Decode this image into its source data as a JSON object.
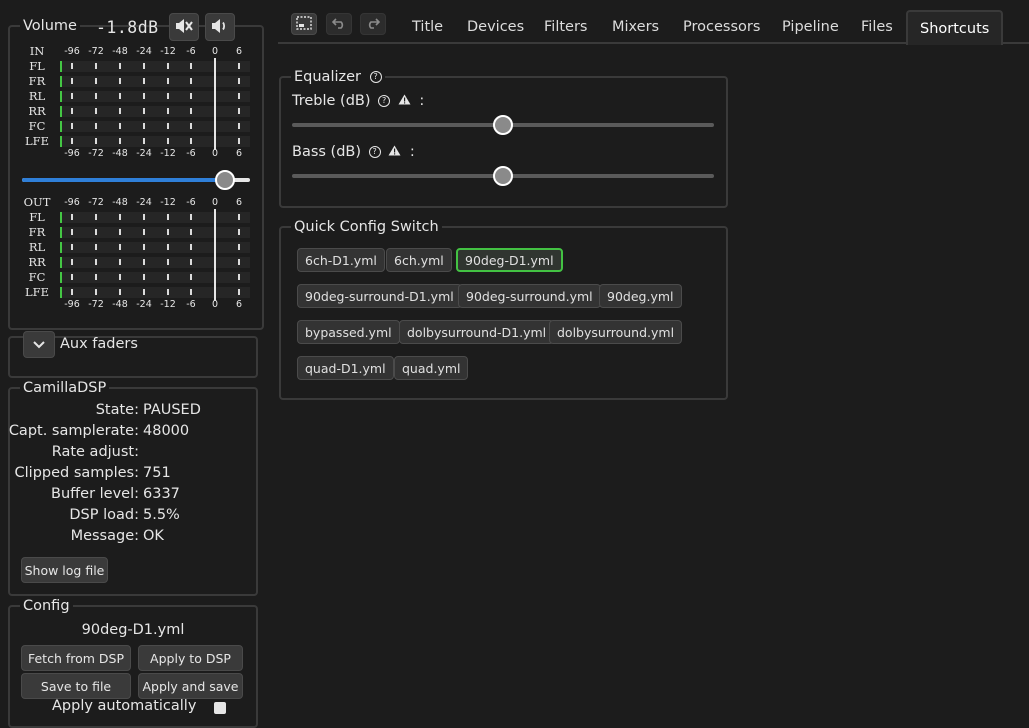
{
  "volume": {
    "legend": "Volume",
    "value": "-1.8dB",
    "level_fraction": 0.93,
    "in_label": "IN",
    "out_label": "OUT",
    "channels": [
      "FL",
      "FR",
      "RL",
      "RR",
      "FC",
      "LFE"
    ],
    "scale": [
      "-96",
      "-72",
      "-48",
      "-24",
      "-12",
      "-6",
      "0",
      "6"
    ]
  },
  "aux": {
    "label": "Aux faders"
  },
  "camilla": {
    "legend": "CamillaDSP",
    "rows": [
      {
        "label": "State:",
        "value": "PAUSED"
      },
      {
        "label": "Capt. samplerate:",
        "value": "48000"
      },
      {
        "label": "Rate adjust:",
        "value": ""
      },
      {
        "label": "Clipped samples:",
        "value": "751"
      },
      {
        "label": "Buffer level:",
        "value": "6337"
      },
      {
        "label": "DSP load:",
        "value": "5.5%"
      },
      {
        "label": "Message:",
        "value": "OK"
      }
    ],
    "log_button": "Show log file"
  },
  "config": {
    "legend": "Config",
    "filename": "90deg-D1.yml",
    "fetch": "Fetch from DSP",
    "apply": "Apply to DSP",
    "save": "Save to file",
    "apply_save": "Apply and save",
    "auto": "Apply automatically"
  },
  "tabs": [
    "Title",
    "Devices",
    "Filters",
    "Mixers",
    "Processors",
    "Pipeline",
    "Files",
    "Shortcuts"
  ],
  "active_tab": "Shortcuts",
  "equalizer": {
    "legend": "Equalizer",
    "treble_label": "Treble (dB)",
    "bass_label": "Bass (dB)",
    "colon": ":",
    "treble_fraction": 0.5,
    "bass_fraction": 0.5
  },
  "quick": {
    "legend": "Quick Config Switch",
    "selected": "90deg-D1.yml",
    "rows": [
      [
        "6ch-D1.yml",
        "6ch.yml",
        "90deg-D1.yml"
      ],
      [
        "90deg-surround-D1.yml",
        "90deg-surround.yml",
        "90deg.yml"
      ],
      [
        "bypassed.yml",
        "dolbysurround-D1.yml",
        "dolbysurround.yml"
      ],
      [
        "quad-D1.yml",
        "quad.yml"
      ]
    ]
  },
  "colors": {
    "accent": "#2f7fd8",
    "meter_green": "#44c744",
    "selected_border": "#43c243"
  }
}
